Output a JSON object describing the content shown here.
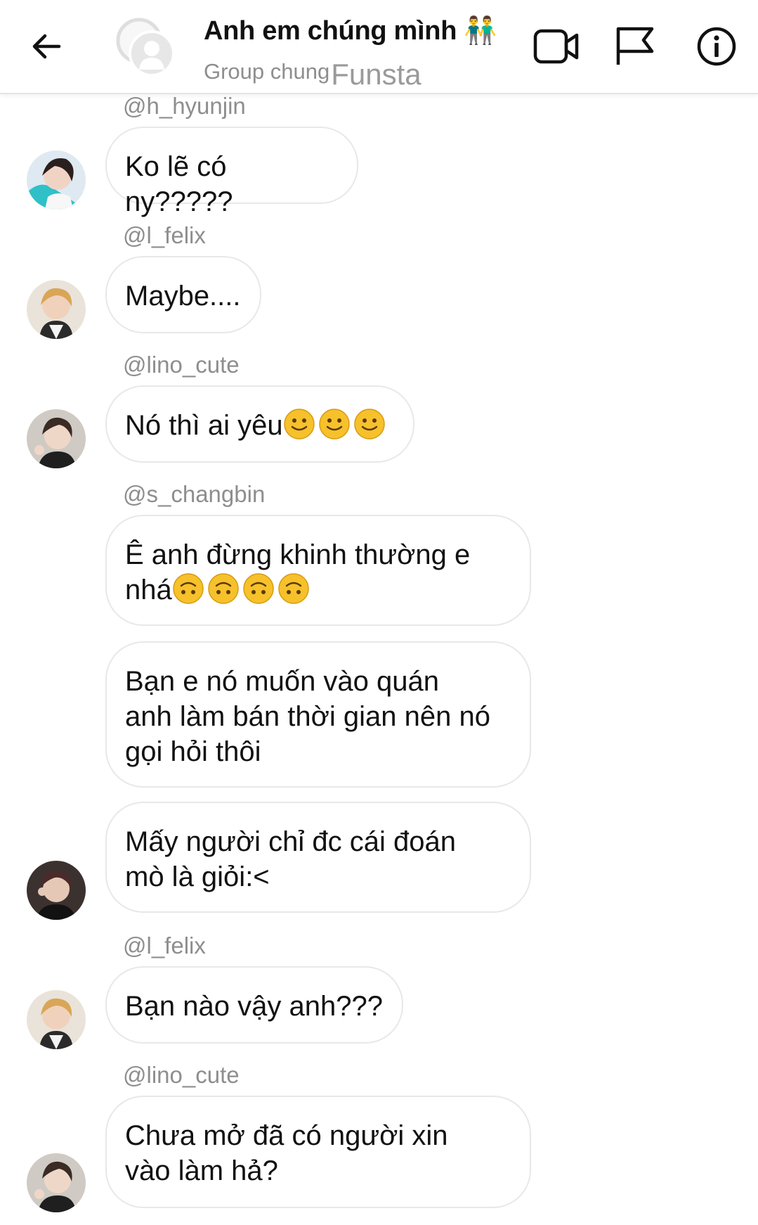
{
  "header": {
    "title": "Anh em chúng mình 👬",
    "subtitle": "Group chung",
    "overlay": "Funsta",
    "icons": {
      "back": "arrow-left-icon",
      "video": "video-call-icon",
      "flag": "flag-icon",
      "info": "info-icon"
    }
  },
  "messages": [
    {
      "username": "@h_hyunjin",
      "text": "Ko lẽ có ny?????",
      "emoji": []
    },
    {
      "username": "@l_felix",
      "text": "Maybe....",
      "emoji": []
    },
    {
      "username": "@lino_cute",
      "text": "Nó thì ai yêu",
      "emoji": [
        "slightly-smiling-face",
        "slightly-smiling-face",
        "slightly-smiling-face"
      ]
    },
    {
      "username": "@s_changbin",
      "text": "Ê anh đừng khinh thường e\nnhá",
      "emoji": [
        "upside-down-face",
        "upside-down-face",
        "upside-down-face",
        "upside-down-face"
      ]
    },
    {
      "username": "",
      "text": "Bạn e nó muốn vào quán\nanh làm bán thời gian nên nó\ngọi hỏi thôi",
      "emoji": []
    },
    {
      "username": "",
      "text": "Mấy người chỉ đc cái đoán\nmò là giỏi:<",
      "emoji": []
    },
    {
      "username": "@l_felix",
      "text": "Bạn nào vậy anh???",
      "emoji": []
    },
    {
      "username": "@lino_cute",
      "text": "Chưa mở đã có người xin\nvào làm hả?",
      "emoji": []
    }
  ],
  "colors": {
    "bubble_border": "#e8e8e8",
    "username": "#8e8e8e",
    "emoji_yellow": "#f6c12b"
  }
}
